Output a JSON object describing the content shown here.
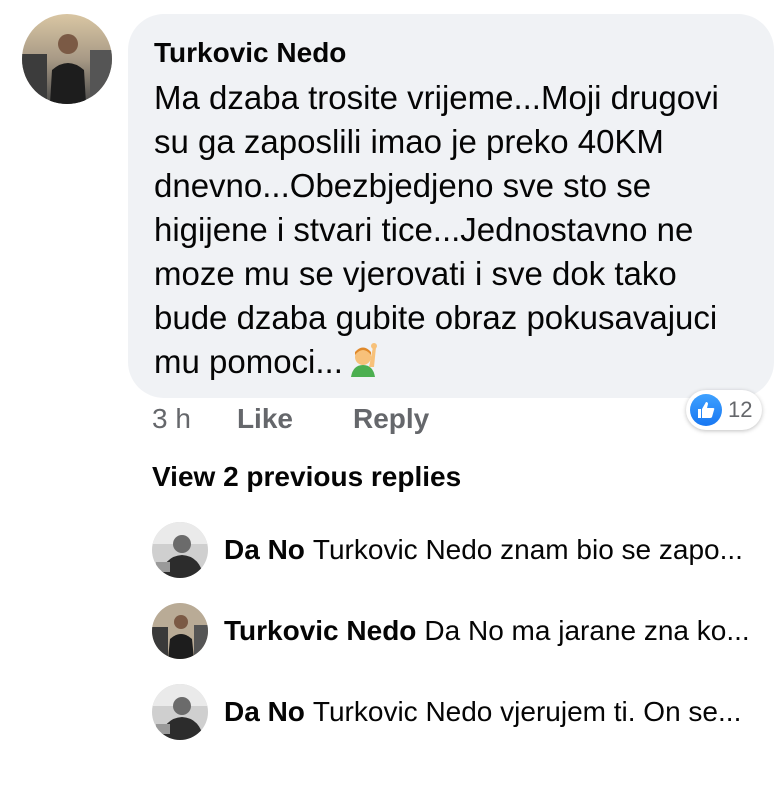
{
  "comment": {
    "author": "Turkovic Nedo",
    "text": "Ma dzaba trosite vrijeme...Moji drugovi su ga zaposlili imao je preko 40KM dnevno...Obezbjedjeno sve sto se higijene i stvari tice...Jednostavno ne moze mu se vjerovati i sve dok tako bude dzaba gubite obraz pokusavajuci mu pomoci...",
    "emoji": "raising-hand-emoji",
    "time": "3 h",
    "like_label": "Like",
    "reply_label": "Reply",
    "reaction_count": "12",
    "reaction_icon": "thumbs-up-icon",
    "accent_color": "#1877f2"
  },
  "view_previous": "View 2 previous replies",
  "replies": [
    {
      "author": "Da No",
      "text": "Turkovic Nedo znam bio se zapo..."
    },
    {
      "author": "Turkovic Nedo",
      "text": "Da No ma jarane zna ko..."
    },
    {
      "author": "Da No",
      "text": "Turkovic Nedo vjerujem ti. On se..."
    }
  ]
}
